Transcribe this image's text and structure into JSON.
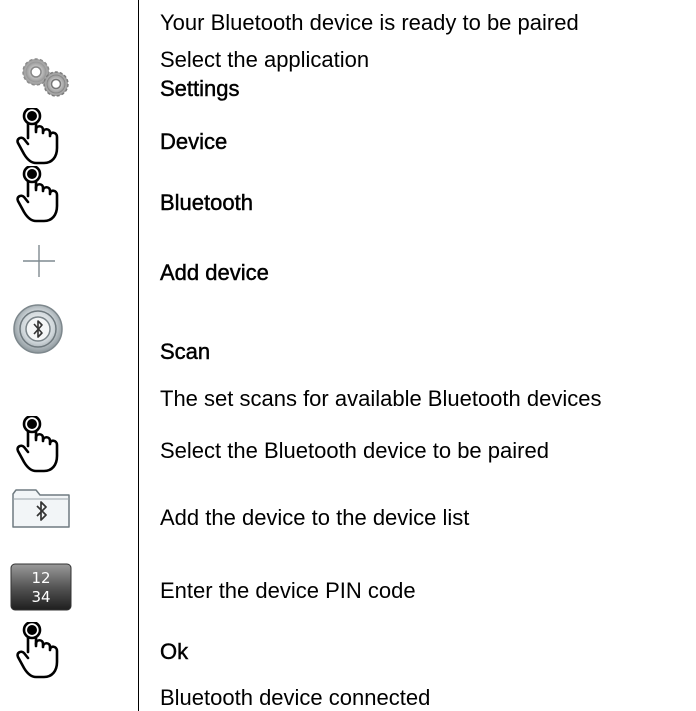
{
  "steps": [
    {
      "text": "Your Bluetooth device is ready to be paired",
      "kind": "instruction",
      "icon": null
    },
    {
      "text": "Select the application",
      "kind": "instruction",
      "icon": "gears-icon"
    },
    {
      "text": "Settings",
      "kind": "action",
      "icon": null
    },
    {
      "text": "Device",
      "kind": "action",
      "icon": "hand-pointer-icon"
    },
    {
      "text": "Bluetooth",
      "kind": "action",
      "icon": "hand-pointer-icon"
    },
    {
      "text": "Add device",
      "kind": "action",
      "icon": "plus-icon"
    },
    {
      "text": "Scan",
      "kind": "action",
      "icon": "bluetooth-scan-icon"
    },
    {
      "text": "The set scans for available Bluetooth devices",
      "kind": "instruction",
      "icon": null
    },
    {
      "text": "Select the Bluetooth device to be paired",
      "kind": "instruction",
      "icon": "hand-pointer-icon"
    },
    {
      "text": "Add the device to the device list",
      "kind": "instruction",
      "icon": "bluetooth-folder-icon"
    },
    {
      "text": "Enter the device PIN code",
      "kind": "instruction",
      "icon": "keypad-1234-icon"
    },
    {
      "text": "Ok",
      "kind": "action",
      "icon": "hand-pointer-icon"
    },
    {
      "text": "Bluetooth device connected",
      "kind": "instruction",
      "icon": null
    }
  ],
  "keypad": {
    "top": "12",
    "bottom": "34"
  }
}
